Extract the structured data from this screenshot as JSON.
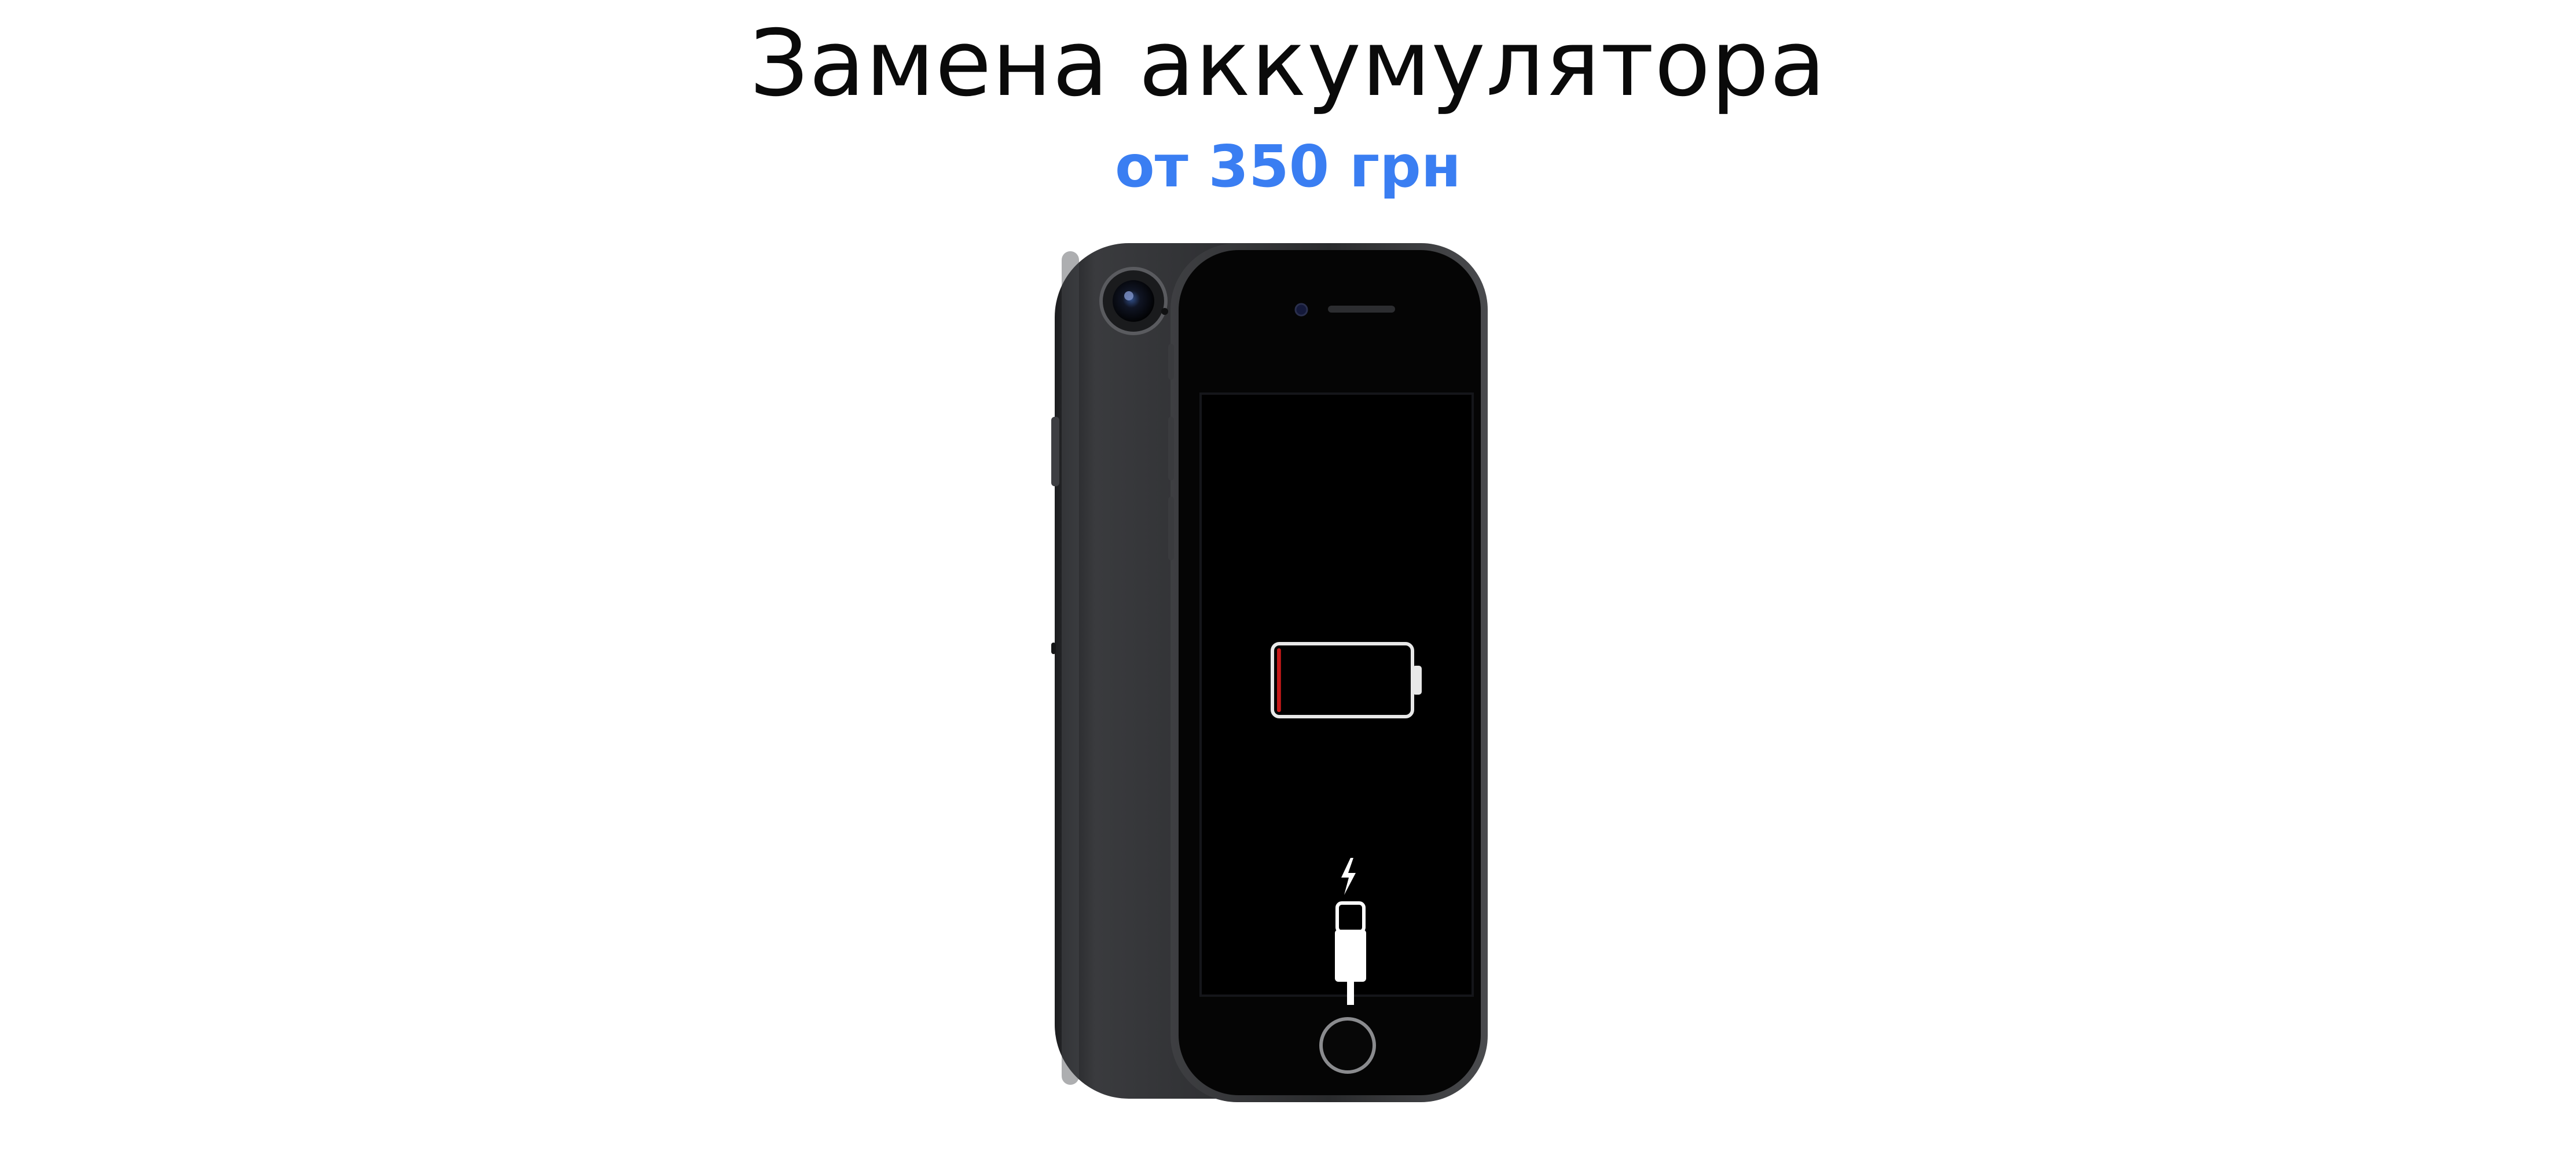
{
  "heading": {
    "title": "Замена аккумулятора",
    "price": "от 350 грн"
  },
  "colors": {
    "price_accent": "#3a7ef2",
    "battery_low": "#c71a1a",
    "phone_body": "#2b2c2e",
    "screen": "#000000"
  },
  "screen": {
    "battery_level_percent": 3,
    "icons": [
      "battery-empty-icon",
      "lightning-bolt-icon",
      "lightning-cable-icon"
    ]
  }
}
